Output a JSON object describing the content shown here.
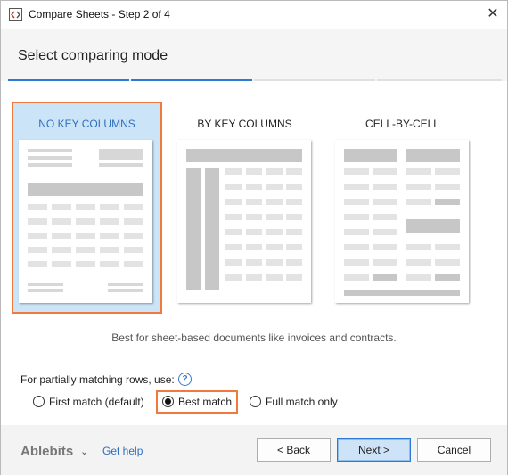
{
  "window": {
    "title": "Compare Sheets - Step 2 of 4",
    "close_glyph": "✕"
  },
  "header": {
    "title": "Select comparing mode",
    "progress_steps": 4,
    "progress_color": "#2c7ad6"
  },
  "modes": [
    {
      "label": "NO KEY COLUMNS",
      "selected": true
    },
    {
      "label": "BY KEY COLUMNS",
      "selected": false
    },
    {
      "label": "CELL-BY-CELL",
      "selected": false
    }
  ],
  "description": "Best for sheet-based documents like invoices and contracts.",
  "partial_match": {
    "label": "For partially matching rows, use:",
    "help_glyph": "?",
    "options": [
      {
        "label": "First match (default)",
        "checked": false
      },
      {
        "label": "Best match",
        "checked": true
      },
      {
        "label": "Full match only",
        "checked": false
      }
    ]
  },
  "footer": {
    "brand": "Ablebits",
    "brand_chevron": "⌄",
    "help_link": "Get help",
    "back_label": "< Back",
    "next_label": "Next >",
    "cancel_label": "Cancel"
  },
  "colors": {
    "accent": "#2c7ad6",
    "highlight_border": "#f0793c",
    "selected_card_bg": "#cce4f7"
  }
}
